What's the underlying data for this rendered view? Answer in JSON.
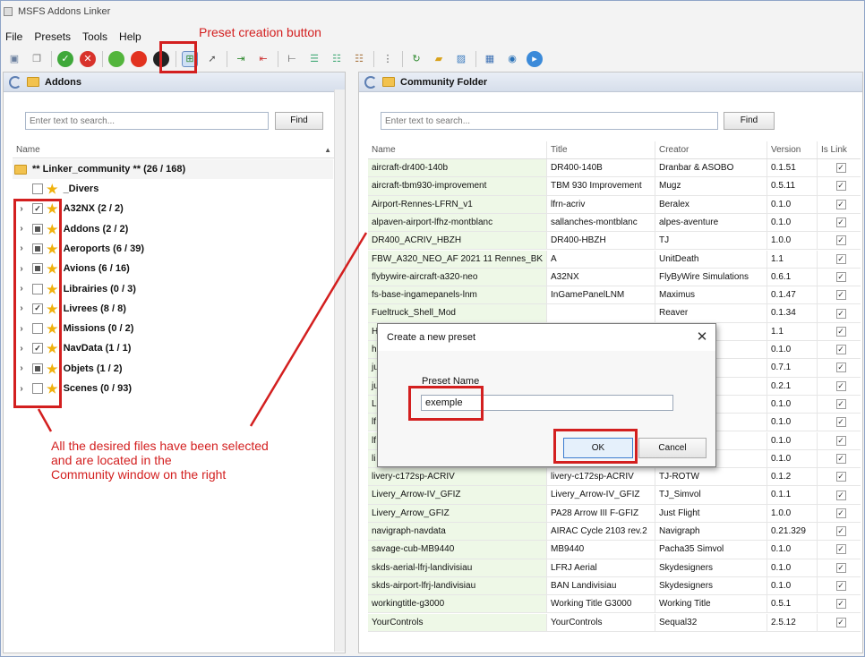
{
  "window": {
    "title": "MSFS Addons Linker"
  },
  "menu": [
    "File",
    "Presets",
    "Tools",
    "Help"
  ],
  "toolbar_icons": [
    "open-icon",
    "copy-icon",
    "check-green-icon",
    "cancel-red-icon",
    "green-dot-icon",
    "red-dot-icon",
    "black-dot-icon",
    "create-preset-icon",
    "cursor-icon",
    "link-add-icon",
    "link-remove-icon",
    "tree-icon",
    "list-icon",
    "list-check-icon",
    "list-uncheck-icon",
    "tree-expand-icon",
    "refresh-icon",
    "folder-icon",
    "image-icon",
    "table-icon",
    "globe-icon",
    "play-icon"
  ],
  "left_panel": {
    "title": "Addons",
    "search_placeholder": "Enter text to search...",
    "find_label": "Find",
    "column_name": "Name",
    "root_label": "** Linker_community ** (26 / 168)",
    "items": [
      {
        "label": "_Divers",
        "state": "unchecked",
        "expandable": false
      },
      {
        "label": "A32NX (2 / 2)",
        "state": "checked",
        "expandable": true
      },
      {
        "label": "Addons (2 / 2)",
        "state": "partial",
        "expandable": true
      },
      {
        "label": "Aeroports (6 / 39)",
        "state": "partial",
        "expandable": true
      },
      {
        "label": "Avions (6 / 16)",
        "state": "partial",
        "expandable": true
      },
      {
        "label": "Librairies (0 / 3)",
        "state": "unchecked",
        "expandable": true
      },
      {
        "label": "Livrees (8 / 8)",
        "state": "checked",
        "expandable": true
      },
      {
        "label": "Missions (0 / 2)",
        "state": "unchecked",
        "expandable": true
      },
      {
        "label": "NavData (1 / 1)",
        "state": "checked",
        "expandable": true
      },
      {
        "label": "Objets (1 / 2)",
        "state": "partial",
        "expandable": true
      },
      {
        "label": "Scenes (0 / 93)",
        "state": "unchecked",
        "expandable": true
      }
    ]
  },
  "right_panel": {
    "title": "Community Folder",
    "search_placeholder": "Enter text to search...",
    "find_label": "Find",
    "columns": [
      "Name",
      "Title",
      "Creator",
      "Version",
      "Is Link"
    ],
    "rows": [
      [
        "aircraft-dr400-140b",
        "DR400-140B",
        "Dranbar & ASOBO",
        "0.1.51"
      ],
      [
        "aircraft-tbm930-improvement",
        "TBM 930 Improvement",
        "Mugz",
        "0.5.11"
      ],
      [
        "Airport-Rennes-LFRN_v1",
        "lfrn-acriv",
        "Beralex",
        "0.1.0"
      ],
      [
        "alpaven-airport-lfhz-montblanc",
        "sallanches-montblanc",
        "alpes-aventure",
        "0.1.0"
      ],
      [
        "DR400_ACRIV_HBZH",
        "DR400-HBZH",
        "TJ",
        "1.0.0"
      ],
      [
        "FBW_A320_NEO_AF 2021 11 Rennes_BK",
        "A",
        "UnitDeath",
        "1.1"
      ],
      [
        "flybywire-aircraft-a320-neo",
        "A32NX",
        "FlyByWire Simulations",
        "0.6.1"
      ],
      [
        "fs-base-ingamepanels-lnm",
        "InGamePanelLNM",
        "Maximus",
        "0.1.47"
      ],
      [
        "Fueltruck_Shell_Mod",
        "",
        "Reaver",
        "0.1.34"
      ],
      [
        "H",
        "",
        "",
        "1.1"
      ],
      [
        "h",
        "",
        "ance Group",
        "0.1.0"
      ],
      [
        "ju",
        "",
        "",
        "0.7.1"
      ],
      [
        "ju",
        "",
        "",
        "0.2.1"
      ],
      [
        "L",
        "",
        "ol",
        "0.1.0"
      ],
      [
        "lf",
        "",
        "",
        "0.1.0"
      ],
      [
        "lf",
        "",
        "",
        "0.1.0"
      ],
      [
        "li",
        "",
        "",
        "0.1.0"
      ],
      [
        "livery-c172sp-ACRIV",
        "livery-c172sp-ACRIV",
        "TJ-ROTW",
        "0.1.2"
      ],
      [
        "Livery_Arrow-IV_GFIZ",
        "Livery_Arrow-IV_GFIZ",
        "TJ_Simvol",
        "0.1.1"
      ],
      [
        "Livery_Arrow_GFIZ",
        "PA28 Arrow III F-GFIZ",
        "Just Flight",
        "1.0.0"
      ],
      [
        "navigraph-navdata",
        "AIRAC Cycle 2103 rev.2",
        "Navigraph",
        "0.21.329"
      ],
      [
        "savage-cub-MB9440",
        "MB9440",
        "Pacha35 Simvol",
        "0.1.0"
      ],
      [
        "skds-aerial-lfrj-landivisiau",
        "LFRJ Aerial",
        "Skydesigners",
        "0.1.0"
      ],
      [
        "skds-airport-lfrj-landivisiau",
        "BAN Landivisiau",
        "Skydesigners",
        "0.1.0"
      ],
      [
        "workingtitle-g3000",
        "Working Title G3000",
        "Working Title",
        "0.5.1"
      ],
      [
        "YourControls",
        "YourControls",
        "Sequal32",
        "2.5.12"
      ]
    ]
  },
  "dialog": {
    "title": "Create a new preset",
    "field_label": "Preset Name",
    "field_value": "exemple",
    "ok_label": "OK",
    "cancel_label": "Cancel"
  },
  "annotations": {
    "preset_button": "Preset creation button",
    "note_line1": "All the desired files have been selected",
    "note_line2": "and are located in the",
    "note_line3": "Community window on the right"
  }
}
